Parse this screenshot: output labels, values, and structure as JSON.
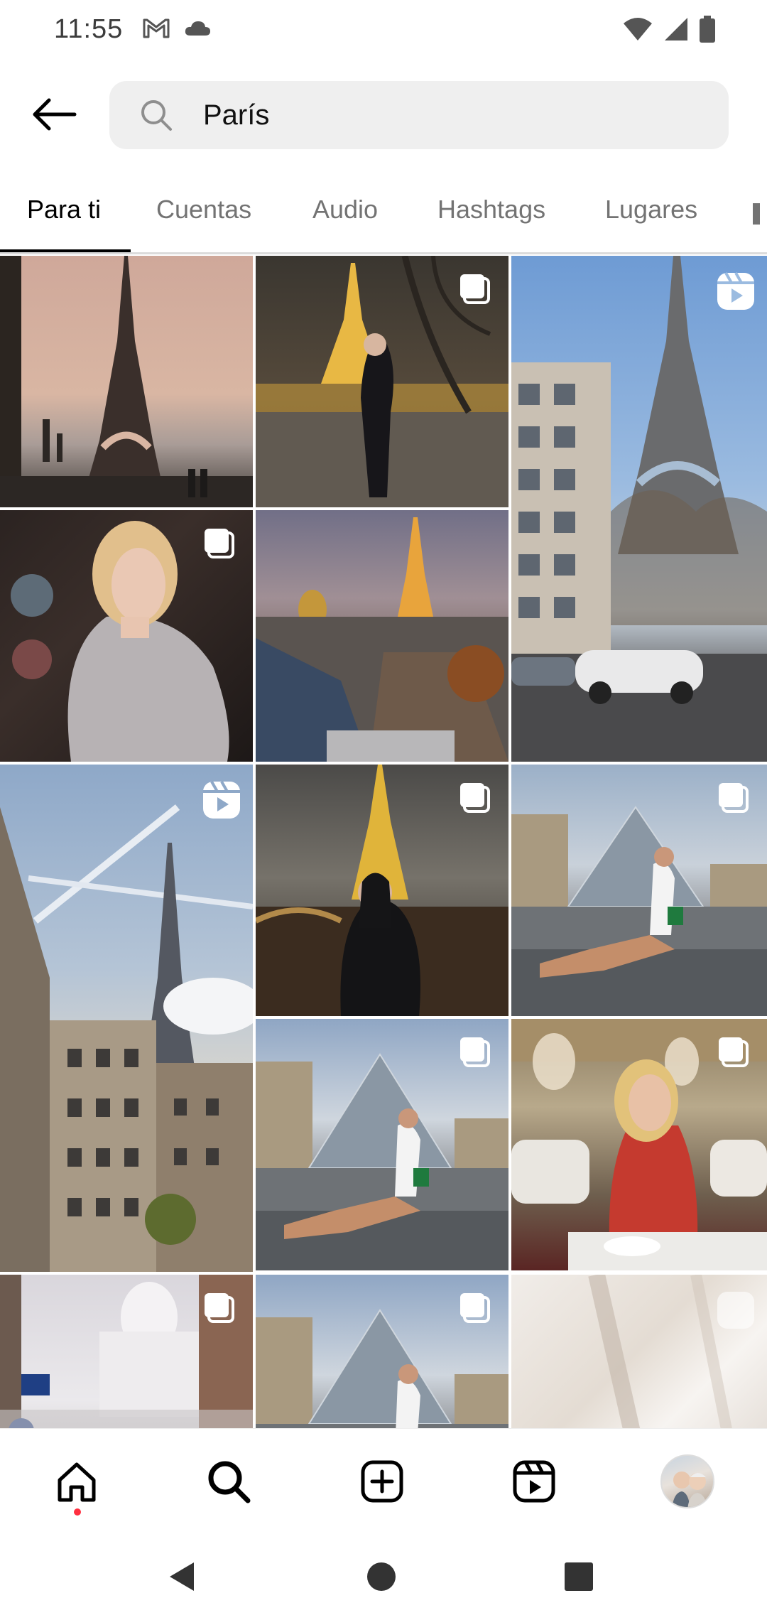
{
  "status_bar": {
    "time": "11:55",
    "left_icons": [
      "gmail-icon",
      "cloud-icon"
    ],
    "right_icons": [
      "wifi-icon",
      "signal-icon",
      "battery-icon"
    ]
  },
  "search": {
    "value": "París",
    "back_icon": "arrow-left-icon",
    "search_icon": "search-icon"
  },
  "tabs": [
    {
      "label": "Para ti",
      "active": true
    },
    {
      "label": "Cuentas",
      "active": false
    },
    {
      "label": "Audio",
      "active": false
    },
    {
      "label": "Hashtags",
      "active": false
    },
    {
      "label": "Lugares",
      "active": false
    }
  ],
  "grid": {
    "tiles": [
      {
        "subject": "eiffel-sunset",
        "badge": "none"
      },
      {
        "subject": "woman-eiffel-night",
        "badge": "carousel"
      },
      {
        "subject": "eiffel-street",
        "badge": "reel"
      },
      {
        "subject": "blonde-woman-sparkle-dress",
        "badge": "carousel"
      },
      {
        "subject": "paris-rooftops-eiffel",
        "badge": "none"
      },
      {
        "subject": "eiffel-buildings-sky",
        "badge": "reel"
      },
      {
        "subject": "woman-eiffel-night-2",
        "badge": "carousel"
      },
      {
        "subject": "woman-louvre-pyramid",
        "badge": "carousel"
      },
      {
        "subject": "woman-louvre-pyramid-2",
        "badge": "carousel"
      },
      {
        "subject": "woman-restaurant",
        "badge": "carousel"
      },
      {
        "subject": "sacre-coeur-snow",
        "badge": "carousel"
      },
      {
        "subject": "woman-louvre-pyramid-3",
        "badge": "carousel"
      },
      {
        "subject": "blurred-interior",
        "badge": "reel"
      }
    ]
  },
  "bottom_nav": {
    "items": [
      "home-icon",
      "search-icon",
      "create-icon",
      "reels-icon",
      "profile-avatar"
    ]
  },
  "system_nav": [
    "back-triangle-icon",
    "home-circle-icon",
    "recents-square-icon"
  ]
}
